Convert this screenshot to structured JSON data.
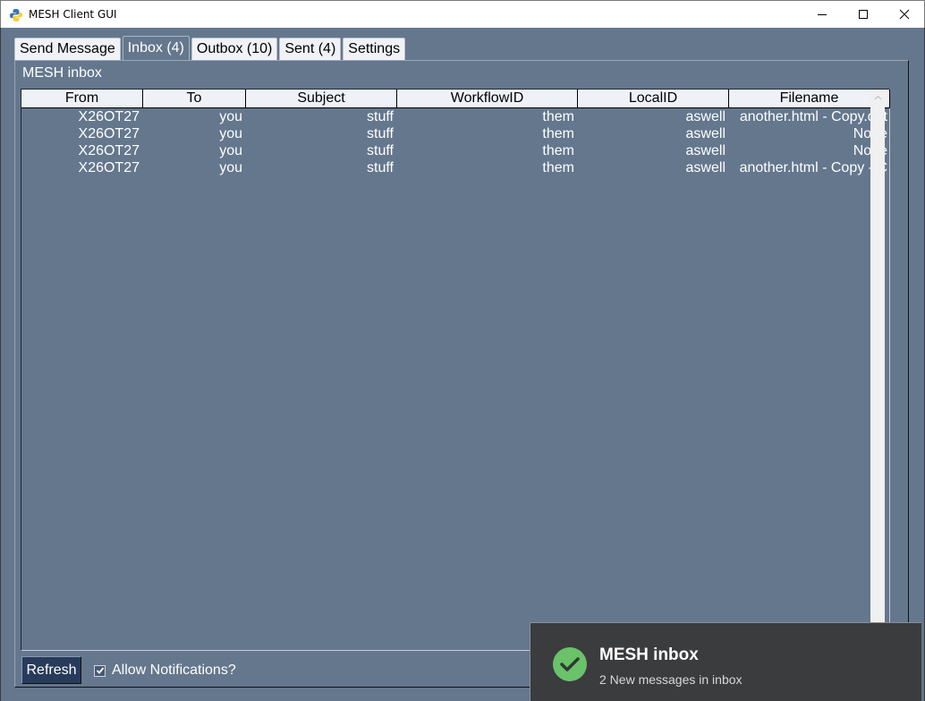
{
  "window": {
    "title": "MESH Client GUI",
    "controls": {
      "minimize": "minimize",
      "maximize": "maximize",
      "close": "close"
    }
  },
  "tabs": [
    {
      "label": "Send Message",
      "active": false
    },
    {
      "label": "Inbox (4)",
      "active": true
    },
    {
      "label": "Outbox (10)",
      "active": false
    },
    {
      "label": "Sent (4)",
      "active": false
    },
    {
      "label": "Settings",
      "active": false
    }
  ],
  "inbox": {
    "title": "MESH inbox",
    "columns": [
      "From",
      "To",
      "Subject",
      "WorkflowID",
      "LocalID",
      "Filename"
    ],
    "rows": [
      [
        "X26OT27",
        "you",
        "stuff",
        "them",
        "aswell",
        "another.html - Copy.dat"
      ],
      [
        "X26OT27",
        "you",
        "stuff",
        "them",
        "aswell",
        "None"
      ],
      [
        "X26OT27",
        "you",
        "stuff",
        "them",
        "aswell",
        "None"
      ],
      [
        "X26OT27",
        "you",
        "stuff",
        "them",
        "aswell",
        "another.html - Copy - C"
      ]
    ]
  },
  "footer": {
    "refresh_label": "Refresh",
    "notifications_label": "Allow Notifications?",
    "notifications_checked": true
  },
  "toast": {
    "title": "MESH inbox",
    "body": "2 New messages in inbox",
    "icon": "check-circle-icon",
    "icon_color": "#6ac26a"
  },
  "colors": {
    "background": "#64778d",
    "button": "#283b5b",
    "toast_background": "#3b3c3e"
  }
}
